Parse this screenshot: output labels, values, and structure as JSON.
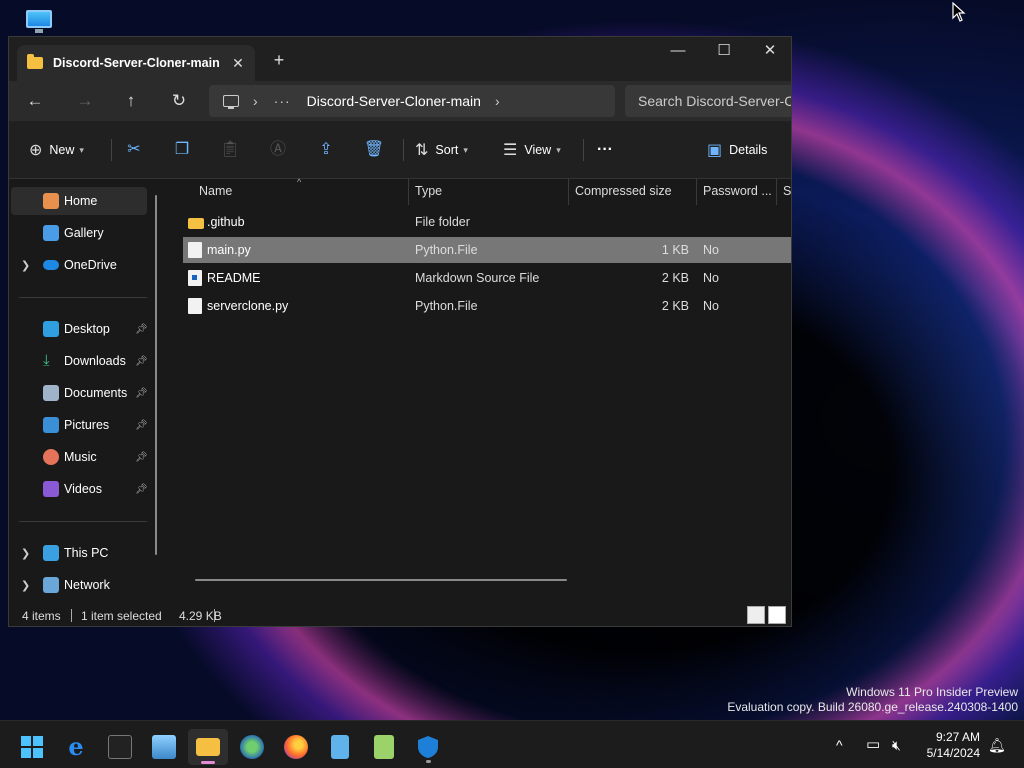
{
  "colors": {
    "accent": "#6fb6ff",
    "folder": "#f5c042",
    "selection": "#777777",
    "taskbar_indicator": "#e68ad8"
  },
  "desktop": {
    "icon": "monitor-icon"
  },
  "window": {
    "tab_title": "Discord-Server-Cloner-main",
    "new_tab_label": "+",
    "address": {
      "overflow": "···",
      "crumb": "Discord-Server-Cloner-main"
    },
    "search_placeholder": "Search Discord-Server-Cl",
    "commands": {
      "new": "New",
      "sort": "Sort",
      "view": "View",
      "more": "···",
      "details": "Details"
    },
    "sidebar": {
      "top": [
        {
          "label": "Home",
          "icon": "home-icon",
          "selected": true
        },
        {
          "label": "Gallery",
          "icon": "gallery-icon"
        },
        {
          "label": "OneDrive",
          "icon": "cloud-icon",
          "expandable": true
        }
      ],
      "quick_access": [
        {
          "label": "Desktop",
          "icon": "desktop-folder-icon"
        },
        {
          "label": "Downloads",
          "icon": "downloads-icon"
        },
        {
          "label": "Documents",
          "icon": "documents-icon"
        },
        {
          "label": "Pictures",
          "icon": "pictures-icon"
        },
        {
          "label": "Music",
          "icon": "music-icon"
        },
        {
          "label": "Videos",
          "icon": "videos-icon"
        }
      ],
      "bottom": [
        {
          "label": "This PC",
          "icon": "this-pc-icon",
          "expandable": true
        },
        {
          "label": "Network",
          "icon": "network-icon",
          "expandable": true
        }
      ]
    },
    "columns": [
      "Name",
      "Type",
      "Compressed size",
      "Password ...",
      "Si"
    ],
    "files": [
      {
        "name": ".github",
        "type": "File folder",
        "size": "",
        "password": "",
        "icon": "folder-icon"
      },
      {
        "name": "main.py",
        "type": "Python.File",
        "size": "1 KB",
        "password": "No",
        "icon": "python-file-icon",
        "selected": true
      },
      {
        "name": "README",
        "type": "Markdown Source File",
        "size": "2 KB",
        "password": "No",
        "icon": "markdown-file-icon"
      },
      {
        "name": "serverclone.py",
        "type": "Python.File",
        "size": "2 KB",
        "password": "No",
        "icon": "python-file-icon"
      }
    ],
    "status": {
      "count": "4 items",
      "selected": "1 item selected",
      "size": "4.29 KB"
    }
  },
  "watermark": {
    "line1": "Windows 11 Pro Insider Preview",
    "line2": "Evaluation copy. Build 26080.ge_release.240308-1400"
  },
  "taskbar": {
    "time": "9:27 AM",
    "date": "5/14/2024",
    "apps": [
      "start-icon",
      "internet-explorer-icon",
      "terminal-icon",
      "control-panel-icon",
      "file-explorer-icon",
      "globe-icon",
      "firefox-icon",
      "notepad-icon",
      "notepad-plus-icon",
      "defender-icon"
    ]
  }
}
